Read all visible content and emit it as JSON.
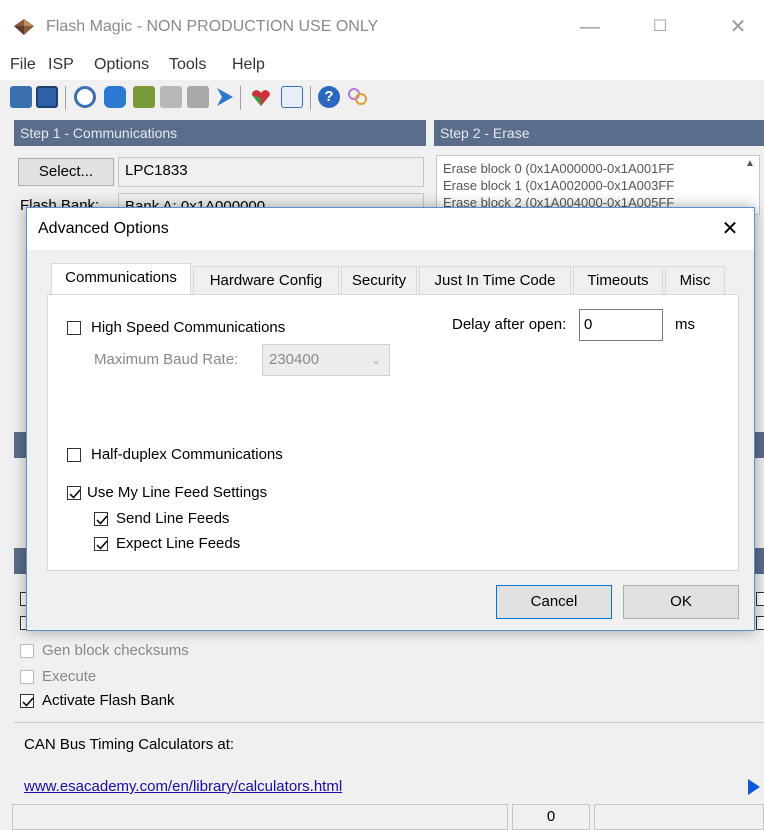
{
  "window": {
    "title": "Flash Magic - NON PRODUCTION USE ONLY",
    "min_glyph": "—",
    "max_glyph": "☐",
    "close_glyph": "✕"
  },
  "menu": [
    "File",
    "ISP",
    "Options",
    "Tools",
    "Help"
  ],
  "toolbar_icons": [
    "open-icon",
    "save-icon",
    "find-device-icon",
    "database-icon",
    "erase-icon",
    "verify-icon",
    "blank-check-icon",
    "go-icon",
    "hex-icon",
    "window-icon",
    "help-icon",
    "users-icon"
  ],
  "step1": {
    "header": "Step 1 - Communications",
    "select_label": "Select...",
    "device": "LPC1833",
    "flash_bank_label": "Flash Bank:",
    "flash_bank_value": "Bank A: 0x1A000000"
  },
  "step2": {
    "header": "Step 2 - Erase",
    "items": [
      "Erase block 0 (0x1A000000-0x1A001FF",
      "Erase block 1 (0x1A002000-0x1A003FF",
      "Erase block 2 (0x1A004000-0x1A005FF"
    ]
  },
  "options": {
    "gen_checksums": "Gen block checksums",
    "execute": "Execute",
    "activate_flash_bank": "Activate Flash Bank"
  },
  "can_bus_text": "CAN Bus Timing Calculators at:",
  "can_bus_link": "www.esacademy.com/en/library/calculators.html",
  "status": {
    "count": "0"
  },
  "dialog": {
    "title": "Advanced Options",
    "close_glyph": "✕",
    "tabs": [
      "Communications",
      "Hardware Config",
      "Security",
      "Just In Time Code",
      "Timeouts",
      "Misc"
    ],
    "high_speed_label": "High Speed Communications",
    "max_baud_label": "Maximum Baud Rate:",
    "max_baud_value": "230400",
    "delay_label": "Delay after open:",
    "delay_value": "0",
    "delay_unit": "ms",
    "half_duplex_label": "Half-duplex Communications",
    "use_line_feed_label": "Use My Line Feed Settings",
    "send_line_feeds_label": "Send Line Feeds",
    "expect_line_feeds_label": "Expect Line Feeds",
    "cancel_label": "Cancel",
    "ok_label": "OK"
  }
}
